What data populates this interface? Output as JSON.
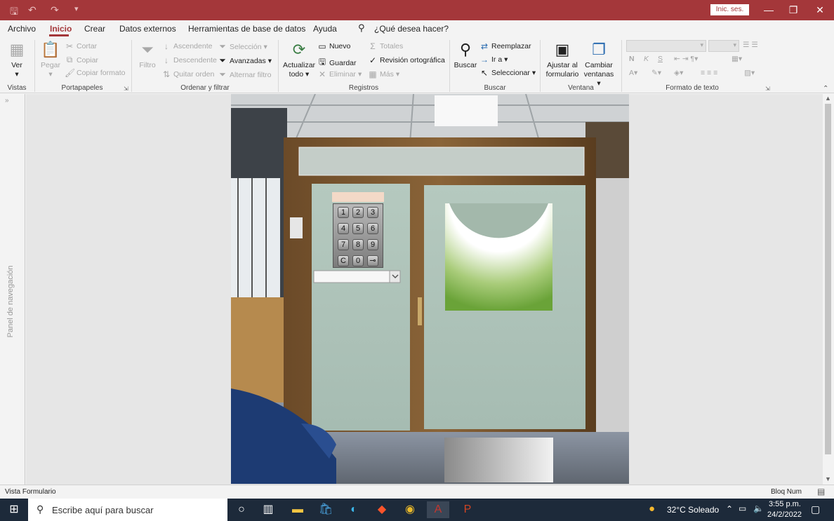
{
  "titlebar": {
    "signin": "Inic. ses.",
    "minimize_icon": "minimize-icon",
    "restore_icon": "restore-icon",
    "close_icon": "close-icon"
  },
  "menu": {
    "tabs": [
      "Archivo",
      "Inicio",
      "Crear",
      "Datos externos",
      "Herramientas de base de datos",
      "Ayuda"
    ],
    "tell_me": "¿Qué desea hacer?"
  },
  "ribbon": {
    "vistas": {
      "ver": "Ver",
      "label": "Vistas"
    },
    "portapapeles": {
      "pegar": "Pegar",
      "cortar": "Cortar",
      "copiar": "Copiar",
      "copiar_formato": "Copiar formato",
      "label": "Portapapeles"
    },
    "ordenar": {
      "filtro": "Filtro",
      "ascendente": "Ascendente",
      "descendente": "Descendente",
      "quitar_orden": "Quitar orden",
      "seleccion": "Selección",
      "avanzadas": "Avanzadas",
      "alternar_filtro": "Alternar filtro",
      "label": "Ordenar y filtrar"
    },
    "registros": {
      "actualizar1": "Actualizar",
      "actualizar2": "todo",
      "nuevo": "Nuevo",
      "guardar": "Guardar",
      "eliminar": "Eliminar",
      "totales": "Totales",
      "revision": "Revisión ortográfica",
      "mas": "Más",
      "label": "Registros"
    },
    "buscar": {
      "buscar": "Buscar",
      "reemplazar": "Reemplazar",
      "ir_a": "Ir a",
      "seleccionar": "Seleccionar",
      "label": "Buscar"
    },
    "ventana": {
      "ajustar1": "Ajustar al",
      "ajustar2": "formulario",
      "cambiar1": "Cambiar",
      "cambiar2": "ventanas",
      "label": "Ventana"
    },
    "formato": {
      "bold": "N",
      "italic": "K",
      "underline": "S",
      "label": "Formato de texto"
    }
  },
  "navpane": {
    "label": "Panel de navegación"
  },
  "form": {
    "keypad_keys": [
      "1",
      "2",
      "3",
      "4",
      "5",
      "6",
      "7",
      "8",
      "9",
      "C",
      "0",
      "⊸"
    ]
  },
  "status": {
    "left": "Vista Formulario",
    "right": "Bloq Num"
  },
  "taskbar": {
    "search_placeholder": "Escribe aquí para buscar",
    "weather": "32°C  Soleado",
    "time": "3:55 p.m.",
    "date": "24/2/2022"
  },
  "colors": {
    "accent": "#a4373a",
    "taskbar": "#1d2a3a"
  }
}
